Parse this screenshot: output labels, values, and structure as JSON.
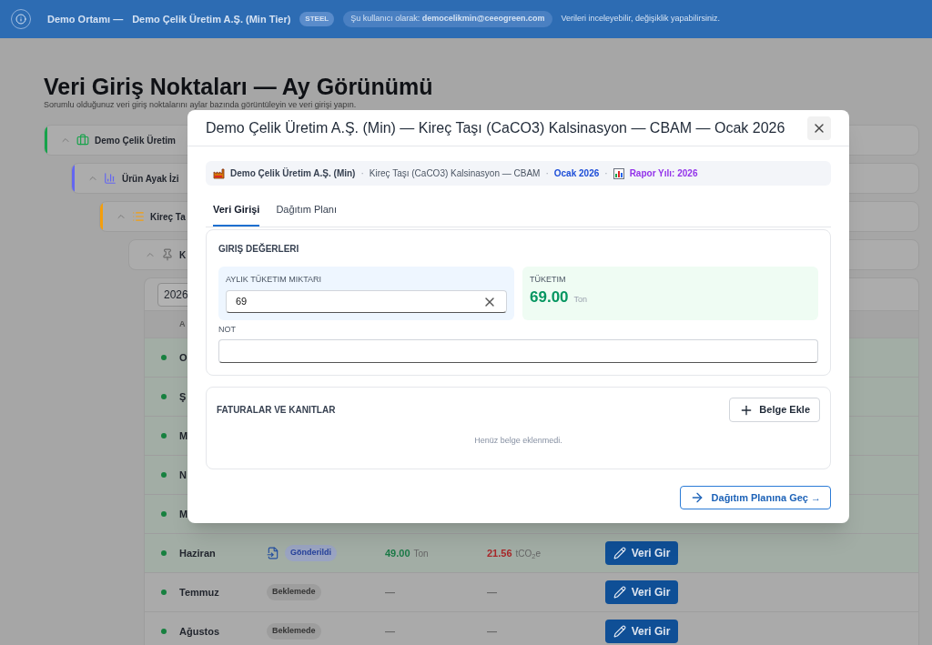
{
  "banner": {
    "environment": "Demo Ortamı —",
    "company": "Demo Çelik Üretim A.Ş. (Min Tier)",
    "tier_badge": "STEEL",
    "user": "Şu kullanıcı olarak: **democelikmin@ceeogreen.com**",
    "note": "Verileri inceleyebilir, değişiklik yapabilirsiniz."
  },
  "page": {
    "title": "Veri Giriş Noktaları — Ay Görünümü",
    "subtitle": "Sorumlu olduğunuz veri giriş noktalarını aylar bazında görüntüleyin ve veri girişi yapın."
  },
  "tree": {
    "label": "Demo Çelik Üretim",
    "kind": "company",
    "color": "#16a34a",
    "expanded": true,
    "children": [
      {
        "label": "Ürün Ayak İzi",
        "kind": "product",
        "color": "#6366f1",
        "expanded": true,
        "children": [
          {
            "label": "Kireç Ta",
            "kind": "process",
            "color": "#f59e0b",
            "expanded": true,
            "children": [
              {
                "label": "K",
                "kind": "point",
                "expanded": true
              }
            ]
          }
        ]
      }
    ]
  },
  "table": {
    "year_select": "2026",
    "columns": [
      "A"
    ],
    "rows": [
      {
        "month": "O",
        "kind": "submitted"
      },
      {
        "month": "Ş",
        "kind": "submitted"
      },
      {
        "month": "M",
        "kind": "submitted"
      },
      {
        "month": "N",
        "kind": "submitted"
      },
      {
        "month": "M",
        "kind": "submitted"
      },
      {
        "month": "Haziran",
        "kind": "submitted",
        "status": "Gönderildi",
        "quantity": "49.00",
        "unit": "Ton",
        "emission": "21.56",
        "emission_unit": "tCO$_{2}$e",
        "action": "Veri Gir"
      },
      {
        "month": "Temmuz",
        "kind": "pending",
        "status": "Beklemede",
        "quantity": "—",
        "emission": "—",
        "action": "Veri Gir"
      },
      {
        "month": "Ağustos",
        "kind": "pending",
        "status": "Beklemede",
        "quantity": "—",
        "emission": "—",
        "action": "Veri Gir"
      }
    ]
  },
  "modal": {
    "title": "Demo Çelik Üretim A.Ş. (Min) — Kireç Taşı (CaCO3) Kalsinasyon — CBAM — Ocak 2026",
    "breadcrumb_separator": "·",
    "breadcrumb": [
      {
        "text": "Demo Çelik Üretim A.Ş. (Min)",
        "kind": "company"
      },
      {
        "text": "Kireç Taşı (CaCO3) Kalsinasyon — CBAM",
        "kind": "process"
      },
      {
        "text": "Ocak 2026",
        "kind": "period"
      },
      {
        "text": "Rapor Yılı: 2026",
        "kind": "report"
      }
    ],
    "tabs": [
      {
        "label": "Veri Girişi",
        "selected": true
      },
      {
        "label": "Dağıtım Planı",
        "selected": false
      }
    ],
    "inputs": {
      "heading": "GIRIŞ DEĞERLERI",
      "quantity": {
        "label": "AYLIK TÜKETIM MIKTARI",
        "value": "69"
      },
      "result": {
        "label": "TÜKETIM",
        "value": "69.00",
        "unit": "Ton"
      },
      "note": {
        "label": "NOT"
      }
    },
    "documents": {
      "heading": "FATURALAR VE KANITLAR",
      "add_button": "Belge Ekle",
      "empty_text": "Henüz belge eklenmedi."
    },
    "next_button": "Dağıtım Planına Geç →"
  }
}
